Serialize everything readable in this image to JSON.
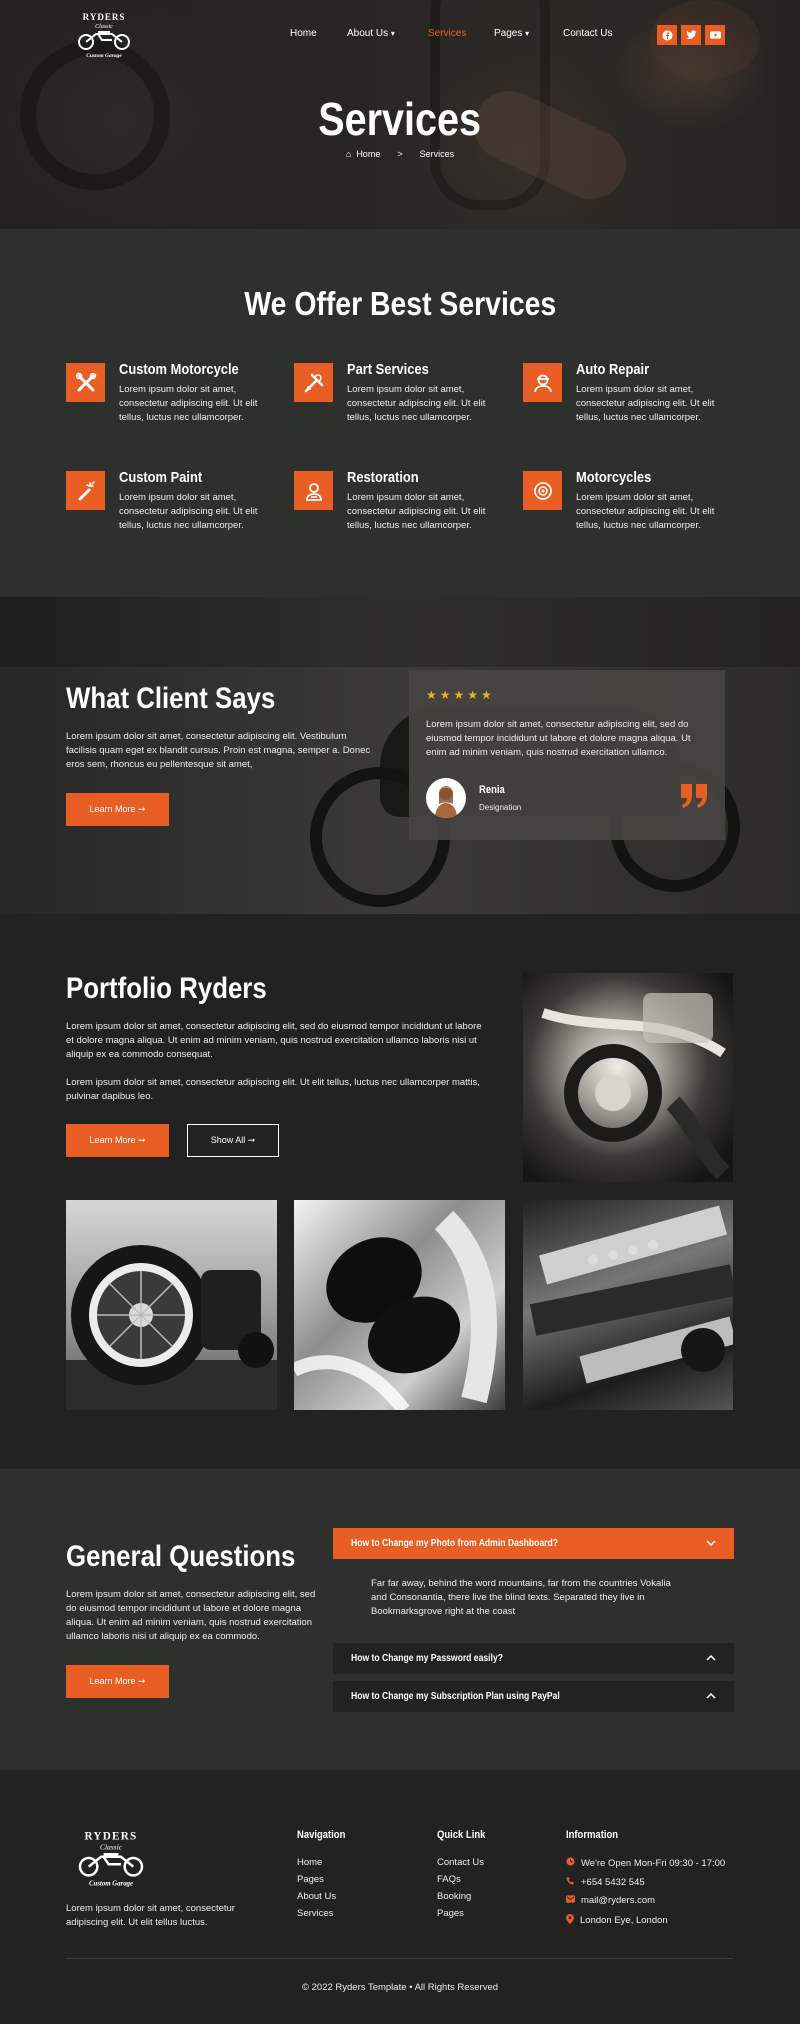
{
  "brand": {
    "name": "RYDERS",
    "tagline": "Classic",
    "sub": "Custom Garage"
  },
  "nav": {
    "items": [
      "Home",
      "About Us",
      "Services",
      "Pages",
      "Contact Us"
    ],
    "active": "Services"
  },
  "social": [
    "facebook-icon",
    "twitter-icon",
    "youtube-icon"
  ],
  "hero": {
    "title": "Services",
    "breadcrumb_home": "Home",
    "breadcrumb_sep": ">",
    "breadcrumb_current": "Services"
  },
  "services": {
    "title": "We Offer Best Services",
    "items": [
      {
        "title": "Custom Motorcycle",
        "icon": "wrench-cross-icon",
        "desc": "Lorem ipsum dolor sit amet, consectetur adipiscing elit. Ut elit tellus, luctus nec ullamcorper."
      },
      {
        "title": "Part Services",
        "icon": "tools-icon",
        "desc": "Lorem ipsum dolor sit amet, consectetur adipiscing elit. Ut elit tellus, luctus nec ullamcorper."
      },
      {
        "title": "Auto Repair",
        "icon": "mechanic-icon",
        "desc": "Lorem ipsum dolor sit amet, consectetur adipiscing elit. Ut elit tellus, luctus nec ullamcorper."
      },
      {
        "title": "Custom Paint",
        "icon": "spray-icon",
        "desc": "Lorem ipsum dolor sit amet, consectetur adipiscing elit. Ut elit tellus, luctus nec ullamcorper."
      },
      {
        "title": "Restoration",
        "icon": "engine-icon",
        "desc": "Lorem ipsum dolor sit amet, consectetur adipiscing elit. Ut elit tellus, luctus nec ullamcorper."
      },
      {
        "title": "Motorcycles",
        "icon": "wheel-icon",
        "desc": "Lorem ipsum dolor sit amet, consectetur adipiscing elit. Ut elit tellus, luctus nec ullamcorper."
      }
    ]
  },
  "testimonial": {
    "title": "What Client Says",
    "desc": "Lorem ipsum dolor sit amet, consectetur adipiscing elit. Vestibulum facilisis quam eget ex blandit cursus. Proin est magna, semper a. Donec eros sem, rhoncus eu pellentesque sit amet,",
    "button": "Learn More ➞",
    "rating": 5,
    "quote": "Lorem ipsum dolor sit amet, consectetur adipiscing elit, sed do eiusmod tempor incididunt ut labore et dolore magna aliqua. Ut enim ad minim veniam, quis nostrud exercitation ullamco.",
    "name": "Renia",
    "role": "Designation"
  },
  "portfolio": {
    "title": "Portfolio Ryders",
    "p1": "Lorem ipsum dolor sit amet, consectetur adipiscing elit, sed do eiusmod tempor incididunt ut labore et dolore magna aliqua. Ut enim ad minim veniam, quis nostrud exercitation ullamco laboris nisi ut aliquip ex ea commodo consequat.",
    "p2": "Lorem ipsum dolor sit amet, consectetur adipiscing elit. Ut elit tellus, luctus nec ullamcorper mattis, pulvinar dapibus leo.",
    "button": "Learn More ➞",
    "show_all": "Show All ➞"
  },
  "faq": {
    "title": "General Questions",
    "desc": "Lorem ipsum dolor sit amet, consectetur adipiscing elit, sed do eiusmod tempor incididunt ut labore et dolore magna aliqua. Ut enim ad minim veniam, quis nostrud exercitation ullamco laboris nisi ut aliquip ex ea commodo.",
    "button": "Learn More ➞",
    "items": [
      {
        "q": "How to Change my Photo from Admin Dashboard?",
        "a": "Far far away, behind the word mountains, far from the countries Vokalia and Consonantia, there live the blind texts. Separated they live in Bookmarksgrove right at the coast"
      },
      {
        "q": "How to Change my Password easily?"
      },
      {
        "q": "How to Change my Subscription Plan using PayPal"
      }
    ]
  },
  "footer": {
    "desc": "Lorem ipsum dolor sit amet, consectetur adipiscing elit. Ut elit tellus luctus.",
    "navigation": {
      "title": "Navigation",
      "links": [
        "Home",
        "Pages",
        "About Us",
        "Services"
      ]
    },
    "quick": {
      "title": "Quick Link",
      "links": [
        "Contact Us",
        "FAQs",
        "Booking",
        "Pages"
      ]
    },
    "info": {
      "title": "Information",
      "items": [
        "We're Open Mon-Fri 09:30 - 17:00",
        "+654 5432 545",
        "mail@ryders.com",
        "London Eye, London"
      ]
    },
    "copyright": "© 2022 Ryders Template • All Rights Reserved"
  },
  "colors": {
    "accent": "#e85e25",
    "dark": "#212221",
    "panel": "#2e302e"
  }
}
